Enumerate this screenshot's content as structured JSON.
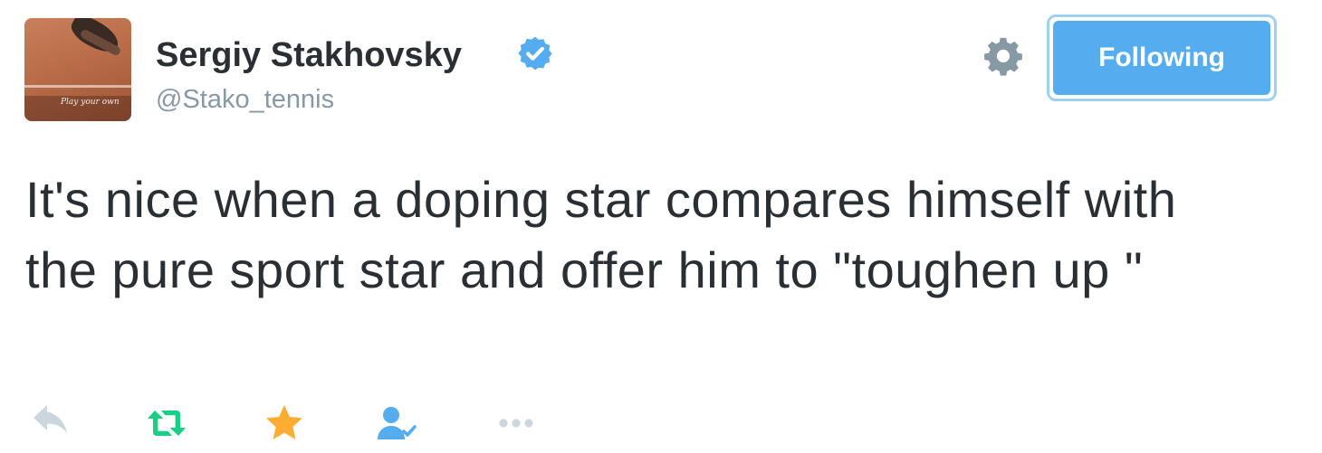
{
  "tweet": {
    "author": {
      "display_name": "Sergiy Stakhovsky",
      "handle": "@Stako_tennis",
      "verified": true,
      "avatar_tagline": "Play your own"
    },
    "follow_button_label": "Following",
    "text": "It's nice when a doping star compares himself with the pure sport star and offer him to \"toughen up \""
  },
  "icons": {
    "verified": "verified-badge-icon",
    "settings": "gear-icon",
    "reply": "reply-icon",
    "retweet": "retweet-icon",
    "favorite": "star-icon",
    "follow": "follow-user-icon",
    "more": "more-dots-icon"
  },
  "colors": {
    "accent_blue": "#55acee",
    "verified_blue": "#55acee",
    "text_primary": "#292f33",
    "text_secondary": "#8899a6",
    "retweet_green": "#19cf86",
    "favorite_gold": "#ffac33"
  }
}
